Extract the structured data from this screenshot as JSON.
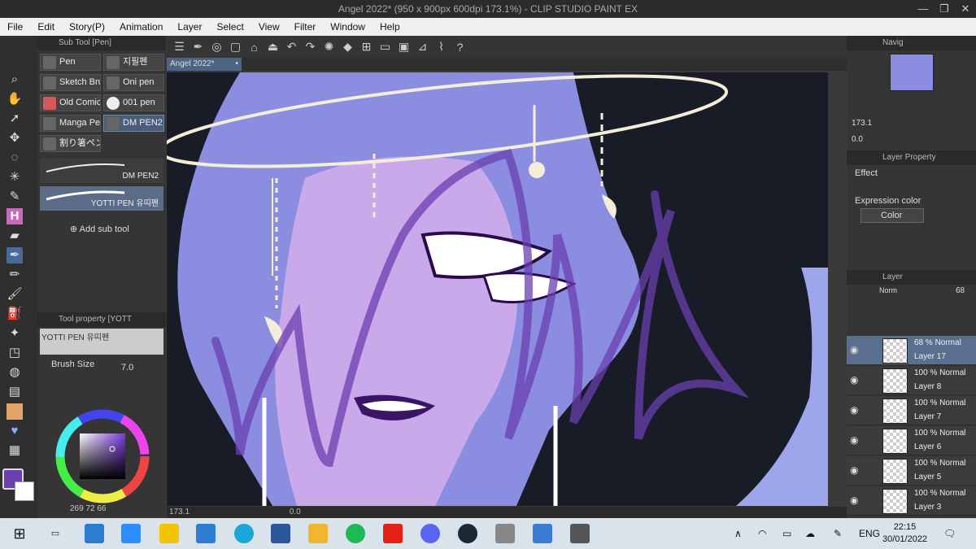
{
  "window": {
    "title": "Angel 2022* (950 x 900px 600dpi 173.1%) - CLIP STUDIO PAINT EX"
  },
  "menu": [
    "File",
    "Edit",
    "Story(P)",
    "Animation",
    "Layer",
    "Select",
    "View",
    "Filter",
    "Window",
    "Help"
  ],
  "subtool_panel": {
    "title": "Sub Tool [Pen]",
    "buttons": [
      "Pen",
      "지필펜",
      "Sketch Bru",
      "Oni pen",
      "Old Comic",
      "001 pen",
      "Manga Pen",
      "DM PEN2",
      "割り箸ペン"
    ],
    "selected": "DM PEN2",
    "brushes": [
      "DM PEN2",
      "YOTTI PEN 유띠펜"
    ],
    "add_label": "Add sub tool"
  },
  "tool_property": {
    "title": "Tool property [YOTT",
    "preset": "YOTTI PEN 유띠펜",
    "brush_size_label": "Brush Size",
    "brush_size_value": "7.0"
  },
  "color_panel": {
    "main_color": "#6c3fb0",
    "readout": "269  72  66"
  },
  "canvas": {
    "tab": "Angel 2022*",
    "zoom": "173.1",
    "angle": "0.0"
  },
  "navigator": {
    "title": "Navig",
    "zoom": "173.1",
    "angle": "0.0"
  },
  "layer_property": {
    "title": "Layer Property",
    "effect_label": "Effect",
    "expression_label": "Expression color",
    "expression_value": "Color"
  },
  "layer_panel": {
    "title": "Layer",
    "blend": "Norm",
    "opacity": "68",
    "layers": [
      {
        "mode": "68 % Normal",
        "name": "Layer 17"
      },
      {
        "mode": "100 % Normal",
        "name": "Layer 8"
      },
      {
        "mode": "100 % Normal",
        "name": "Layer 7"
      },
      {
        "mode": "100 % Normal",
        "name": "Layer 6"
      },
      {
        "mode": "100 % Normal",
        "name": "Layer 5"
      },
      {
        "mode": "100 % Normal",
        "name": "Layer 3"
      }
    ]
  },
  "taskbar": {
    "lang": "ENG",
    "time": "22:15",
    "date": "30/01/2022"
  }
}
